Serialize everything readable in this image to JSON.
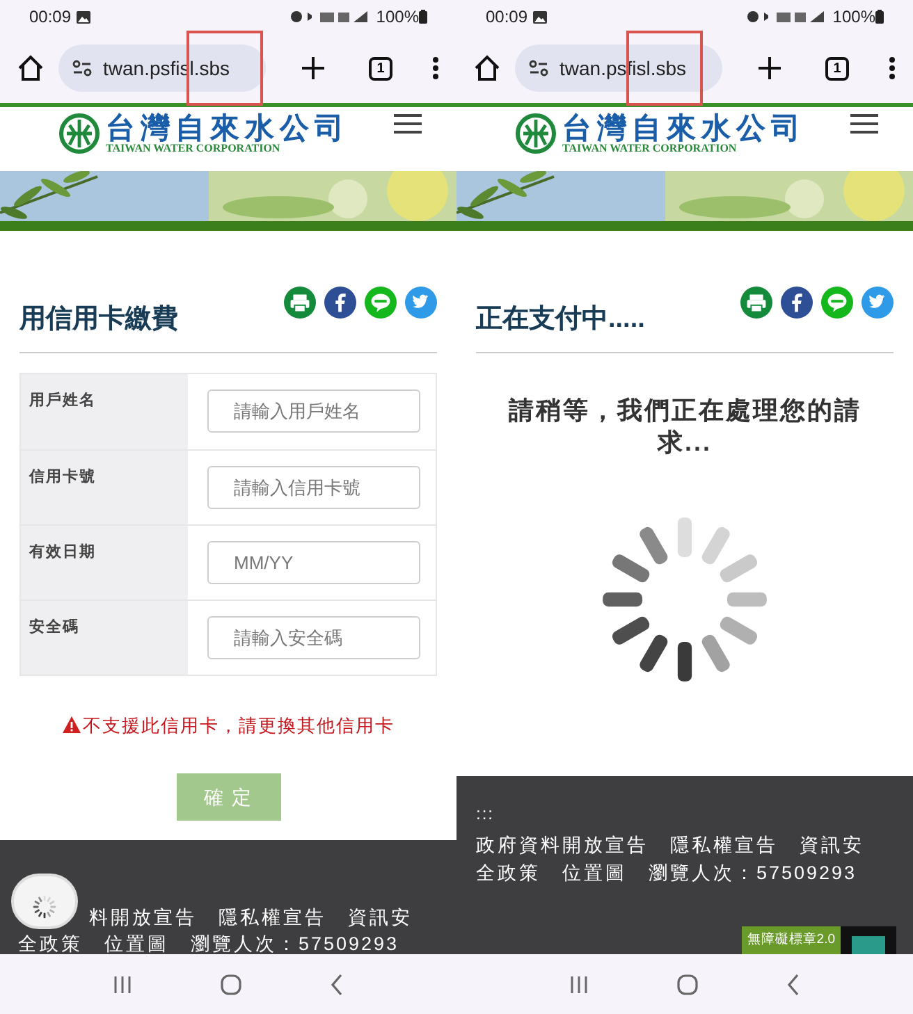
{
  "screens": [
    {
      "kind": "form",
      "status_bar": {
        "time": "00:09",
        "battery": "100%"
      },
      "browser": {
        "url": "twan.psfisl.sbs",
        "tab_count": "1"
      },
      "site": {
        "logo_text": "台灣自來水公司",
        "logo_subtitle": "TAIWAN WATER CORPORATION"
      },
      "title": "用信用卡繳費",
      "fields": [
        {
          "label": "用戶姓名",
          "placeholder": "請輸入用戶姓名"
        },
        {
          "label": "信用卡號",
          "placeholder": "請輸入信用卡號"
        },
        {
          "label": "有效日期",
          "placeholder": "MM/YY"
        },
        {
          "label": "安全碼",
          "placeholder": "請輸入安全碼"
        }
      ],
      "error": "不支援此信用卡，請更換其他信用卡",
      "submit": "確 定",
      "footer": {
        "lines": [
          "料開放宣告　隱私權宣告　資訊安",
          "全政策　位置圖　瀏覽人次：57509293"
        ]
      }
    },
    {
      "kind": "processing",
      "status_bar": {
        "time": "00:09",
        "battery": "100%"
      },
      "browser": {
        "url": "twan.psfisl.sbs",
        "tab_count": "1"
      },
      "site": {
        "logo_text": "台灣自來水公司",
        "logo_subtitle": "TAIWAN WATER CORPORATION"
      },
      "title": "正在支付中.....",
      "message": "請稍等，我們正在處理您的請求...",
      "footer": {
        "marker": ":::",
        "lines": [
          "政府資料開放宣告　隱私權宣告　資訊安",
          "全政策　位置圖　瀏覽人次：57509293"
        ],
        "badge": "無障礙標章2.0"
      }
    }
  ]
}
